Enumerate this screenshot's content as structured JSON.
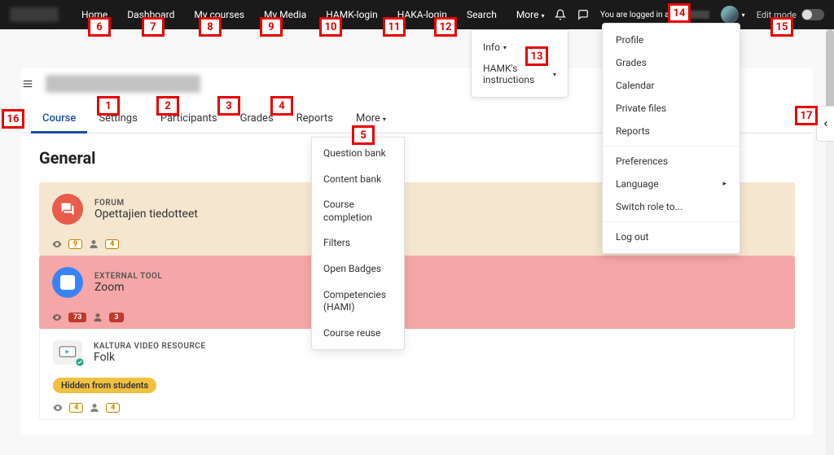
{
  "topnav": {
    "home": "Home",
    "dashboard": "Dashboard",
    "mycourses": "My courses",
    "mymedia": "My Media",
    "hamk": "HAMK-login",
    "haka": "HAKA-login",
    "search": "Search",
    "more": "More"
  },
  "more_dropdown": {
    "info": "Info",
    "hamk_instructions": "HAMK's instructions"
  },
  "user_area": {
    "logged_in_prefix": "You are logged in as",
    "edit_mode": "Edit mode"
  },
  "user_menu": {
    "profile": "Profile",
    "grades": "Grades",
    "calendar": "Calendar",
    "private_files": "Private files",
    "reports": "Reports",
    "preferences": "Preferences",
    "language": "Language",
    "switch_role": "Switch role to...",
    "logout": "Log out"
  },
  "course_tabs": {
    "course": "Course",
    "settings": "Settings",
    "participants": "Participants",
    "grades": "Grades",
    "reports": "Reports",
    "more": "More"
  },
  "course_more_menu": {
    "question_bank": "Question bank",
    "content_bank": "Content bank",
    "course_completion": "Course completion",
    "filters": "Filters",
    "open_badges": "Open Badges",
    "competencies": "Competencies (HAMI)",
    "course_reuse": "Course reuse"
  },
  "section": {
    "general": "General"
  },
  "activities": {
    "forum": {
      "type": "FORUM",
      "title": "Opettajien tiedotteet",
      "views": "9",
      "users": "4"
    },
    "zoom": {
      "type": "EXTERNAL TOOL",
      "title": "Zoom",
      "views": "73",
      "users": "3"
    },
    "kaltura": {
      "type": "KALTURA VIDEO RESOURCE",
      "title": "Folk",
      "hidden": "Hidden from students",
      "views": "4",
      "users": "4"
    }
  },
  "markers": {
    "m1": "1",
    "m2": "2",
    "m3": "3",
    "m4": "4",
    "m5": "5",
    "m6": "6",
    "m7": "7",
    "m8": "8",
    "m9": "9",
    "m10": "10",
    "m11": "11",
    "m12": "12",
    "m13": "13",
    "m14": "14",
    "m15": "15",
    "m16": "16",
    "m17": "17"
  }
}
